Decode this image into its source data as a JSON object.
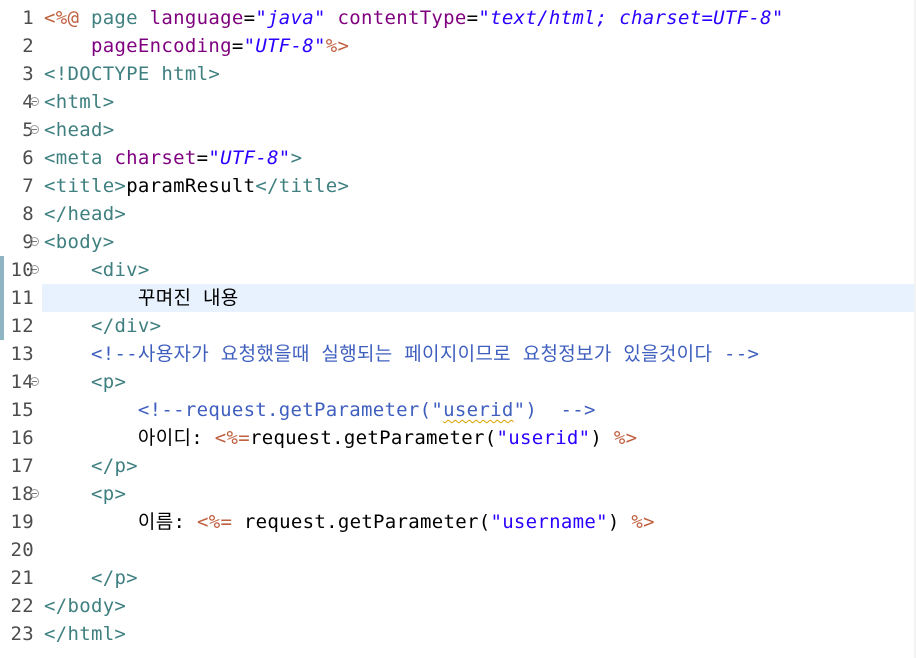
{
  "editor": {
    "current_line": 11,
    "lines": [
      {
        "n": "1",
        "fold": false,
        "tokens": [
          {
            "t": "<%@",
            "c": "jsp"
          },
          {
            "t": " page ",
            "c": "dir"
          },
          {
            "t": "language",
            "c": "attr"
          },
          {
            "t": "=",
            "c": "plain"
          },
          {
            "t": "\"java\"",
            "c": "sval"
          },
          {
            "t": " ",
            "c": "plain"
          },
          {
            "t": "contentType",
            "c": "attr"
          },
          {
            "t": "=",
            "c": "plain"
          },
          {
            "t": "\"text/html; charset=UTF-8\"",
            "c": "sval"
          }
        ]
      },
      {
        "n": "2",
        "fold": false,
        "tokens": [
          {
            "t": "    ",
            "c": "plain"
          },
          {
            "t": "pageEncoding",
            "c": "attr"
          },
          {
            "t": "=",
            "c": "plain"
          },
          {
            "t": "\"UTF-8\"",
            "c": "sval"
          },
          {
            "t": "%>",
            "c": "jsp"
          }
        ]
      },
      {
        "n": "3",
        "fold": false,
        "tokens": [
          {
            "t": "<!DOCTYPE html>",
            "c": "tag"
          }
        ]
      },
      {
        "n": "4",
        "fold": true,
        "tokens": [
          {
            "t": "<html>",
            "c": "tag"
          }
        ]
      },
      {
        "n": "5",
        "fold": true,
        "tokens": [
          {
            "t": "<head>",
            "c": "tag"
          }
        ]
      },
      {
        "n": "6",
        "fold": false,
        "tokens": [
          {
            "t": "<meta ",
            "c": "tag"
          },
          {
            "t": "charset",
            "c": "attr"
          },
          {
            "t": "=",
            "c": "plain"
          },
          {
            "t": "\"UTF-8\"",
            "c": "sval"
          },
          {
            "t": ">",
            "c": "tag"
          }
        ]
      },
      {
        "n": "7",
        "fold": false,
        "tokens": [
          {
            "t": "<title>",
            "c": "tag"
          },
          {
            "t": "paramResult",
            "c": "text"
          },
          {
            "t": "</title>",
            "c": "tag"
          }
        ]
      },
      {
        "n": "8",
        "fold": false,
        "tokens": [
          {
            "t": "</head>",
            "c": "tag"
          }
        ]
      },
      {
        "n": "9",
        "fold": true,
        "tokens": [
          {
            "t": "<body>",
            "c": "tag"
          }
        ]
      },
      {
        "n": "10",
        "fold": true,
        "tokens": [
          {
            "t": "    ",
            "c": "plain"
          },
          {
            "t": "<div>",
            "c": "tag"
          }
        ]
      },
      {
        "n": "11",
        "fold": false,
        "tokens": [
          {
            "t": "        ",
            "c": "plain"
          },
          {
            "t": "꾸며진 내용",
            "c": "text"
          }
        ]
      },
      {
        "n": "12",
        "fold": false,
        "tokens": [
          {
            "t": "    ",
            "c": "plain"
          },
          {
            "t": "</div>",
            "c": "tag"
          }
        ]
      },
      {
        "n": "13",
        "fold": false,
        "tokens": [
          {
            "t": "    ",
            "c": "plain"
          },
          {
            "t": "<!--사용자가 요청했을때 실행되는 페이지이므로 요청정보가 있을것이다 -->",
            "c": "comment"
          }
        ]
      },
      {
        "n": "14",
        "fold": true,
        "tokens": [
          {
            "t": "    ",
            "c": "plain"
          },
          {
            "t": "<p>",
            "c": "tag"
          }
        ]
      },
      {
        "n": "15",
        "fold": false,
        "tokens": [
          {
            "t": "        ",
            "c": "plain"
          },
          {
            "t": "<!--request.getParameter(\"",
            "c": "comment"
          },
          {
            "t": "userid",
            "c": "comment",
            "squiggle": true
          },
          {
            "t": "\")  -->",
            "c": "comment"
          }
        ]
      },
      {
        "n": "16",
        "fold": false,
        "tokens": [
          {
            "t": "        ",
            "c": "plain"
          },
          {
            "t": "아이디: ",
            "c": "text"
          },
          {
            "t": "<%=",
            "c": "jsp"
          },
          {
            "t": "request.getParameter(",
            "c": "plain"
          },
          {
            "t": "\"userid\"",
            "c": "str"
          },
          {
            "t": ") ",
            "c": "plain"
          },
          {
            "t": "%>",
            "c": "jsp"
          }
        ]
      },
      {
        "n": "17",
        "fold": false,
        "tokens": [
          {
            "t": "    ",
            "c": "plain"
          },
          {
            "t": "</p>",
            "c": "tag"
          }
        ]
      },
      {
        "n": "18",
        "fold": true,
        "tokens": [
          {
            "t": "    ",
            "c": "plain"
          },
          {
            "t": "<p>",
            "c": "tag"
          }
        ]
      },
      {
        "n": "19",
        "fold": false,
        "tokens": [
          {
            "t": "        ",
            "c": "plain"
          },
          {
            "t": "이름: ",
            "c": "text"
          },
          {
            "t": "<%=",
            "c": "jsp"
          },
          {
            "t": " request.getParameter(",
            "c": "plain"
          },
          {
            "t": "\"username\"",
            "c": "str"
          },
          {
            "t": ") ",
            "c": "plain"
          },
          {
            "t": "%>",
            "c": "jsp"
          }
        ]
      },
      {
        "n": "20",
        "fold": false,
        "tokens": []
      },
      {
        "n": "21",
        "fold": false,
        "tokens": [
          {
            "t": "    ",
            "c": "plain"
          },
          {
            "t": "</p>",
            "c": "tag"
          }
        ]
      },
      {
        "n": "22",
        "fold": false,
        "tokens": [
          {
            "t": "</body>",
            "c": "tag"
          }
        ]
      },
      {
        "n": "23",
        "fold": false,
        "tokens": [
          {
            "t": "</html>",
            "c": "tag"
          }
        ]
      }
    ]
  },
  "colors": {
    "jsp_delimiter": "#bf5f3f",
    "directive": "#3f7f7f",
    "attribute": "#7f007f",
    "attribute_value": "#2a00ff",
    "tag": "#3f7f7f",
    "comment": "#3f5fbf",
    "string": "#2a00ff",
    "current_line_bg": "#e8f2fe",
    "change_bar": "#8fb4c4"
  }
}
